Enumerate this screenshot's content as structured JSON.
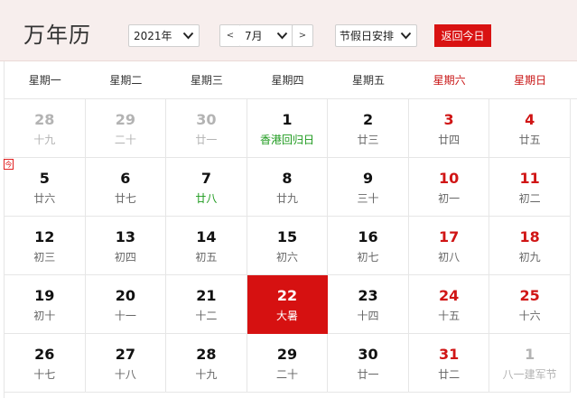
{
  "title": "万年历",
  "controls": {
    "year": "2021年",
    "prev": "<",
    "month": "7月",
    "next": ">",
    "holiday": "节假日安排",
    "today_button": "返回今日"
  },
  "weekdays": [
    "星期一",
    "星期二",
    "星期三",
    "星期四",
    "星期五",
    "星期六",
    "星期日"
  ],
  "today_marker": "今",
  "colors": {
    "accent": "#d91212",
    "weekend": "#d01515",
    "holiday": "#1d9a1d",
    "other_month": "#b3b3b3",
    "header_bg": "#f7eeed"
  },
  "days": [
    {
      "num": "28",
      "lunar": "十九",
      "other": true
    },
    {
      "num": "29",
      "lunar": "二十",
      "other": true
    },
    {
      "num": "30",
      "lunar": "廿一",
      "other": true
    },
    {
      "num": "1",
      "lunar": "香港回归日",
      "holiday": true
    },
    {
      "num": "2",
      "lunar": "廿三"
    },
    {
      "num": "3",
      "lunar": "廿四",
      "weekend": true
    },
    {
      "num": "4",
      "lunar": "廿五",
      "weekend": true
    },
    {
      "num": "5",
      "lunar": "廿六"
    },
    {
      "num": "6",
      "lunar": "廿七"
    },
    {
      "num": "7",
      "lunar": "廿八",
      "holiday": true
    },
    {
      "num": "8",
      "lunar": "廿九"
    },
    {
      "num": "9",
      "lunar": "三十"
    },
    {
      "num": "10",
      "lunar": "初一",
      "weekend": true
    },
    {
      "num": "11",
      "lunar": "初二",
      "weekend": true
    },
    {
      "num": "12",
      "lunar": "初三"
    },
    {
      "num": "13",
      "lunar": "初四"
    },
    {
      "num": "14",
      "lunar": "初五"
    },
    {
      "num": "15",
      "lunar": "初六"
    },
    {
      "num": "16",
      "lunar": "初七"
    },
    {
      "num": "17",
      "lunar": "初八",
      "weekend": true
    },
    {
      "num": "18",
      "lunar": "初九",
      "weekend": true
    },
    {
      "num": "19",
      "lunar": "初十"
    },
    {
      "num": "20",
      "lunar": "十一"
    },
    {
      "num": "21",
      "lunar": "十二"
    },
    {
      "num": "22",
      "lunar": "大暑",
      "selected": true
    },
    {
      "num": "23",
      "lunar": "十四"
    },
    {
      "num": "24",
      "lunar": "十五",
      "weekend": true
    },
    {
      "num": "25",
      "lunar": "十六",
      "weekend": true
    },
    {
      "num": "26",
      "lunar": "十七"
    },
    {
      "num": "27",
      "lunar": "十八"
    },
    {
      "num": "28",
      "lunar": "十九"
    },
    {
      "num": "29",
      "lunar": "二十"
    },
    {
      "num": "30",
      "lunar": "廿一"
    },
    {
      "num": "31",
      "lunar": "廿二",
      "weekend": true
    },
    {
      "num": "1",
      "lunar": "八一建军节",
      "other": true,
      "holiday": true
    }
  ]
}
